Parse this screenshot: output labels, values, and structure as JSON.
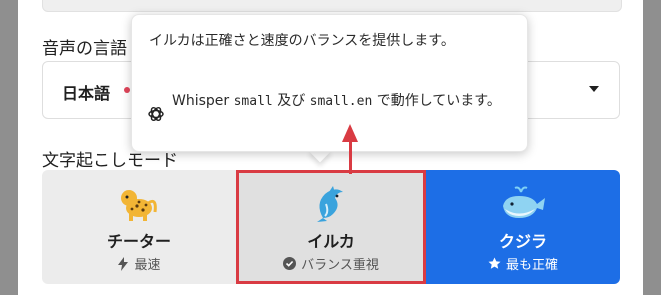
{
  "form": {
    "language_label": "音声の言語",
    "language_value": "日本語",
    "mode_label": "文字起こしモード"
  },
  "tooltip": {
    "description": "イルカは正確さと速度のバランスを提供します。",
    "model_prefix": "Whisper ",
    "model_small": "small",
    "model_join": " 及び ",
    "model_small_en": "small.en",
    "model_suffix": " で動作しています。",
    "model_icon": "openai-logo-icon"
  },
  "modes": [
    {
      "name": "チーター",
      "subtitle": "最速",
      "icon": "lightning-icon",
      "animal": "cheetah-icon"
    },
    {
      "name": "イルカ",
      "subtitle": "バランス重視",
      "icon": "check-circle-icon",
      "animal": "dolphin-icon",
      "selected": true
    },
    {
      "name": "クジラ",
      "subtitle": "最も正確",
      "icon": "star-icon",
      "animal": "whale-icon"
    }
  ],
  "colors": {
    "accent_blue": "#1d6ee6",
    "highlight_red": "#d93b43",
    "required_dot": "#e0455a"
  }
}
